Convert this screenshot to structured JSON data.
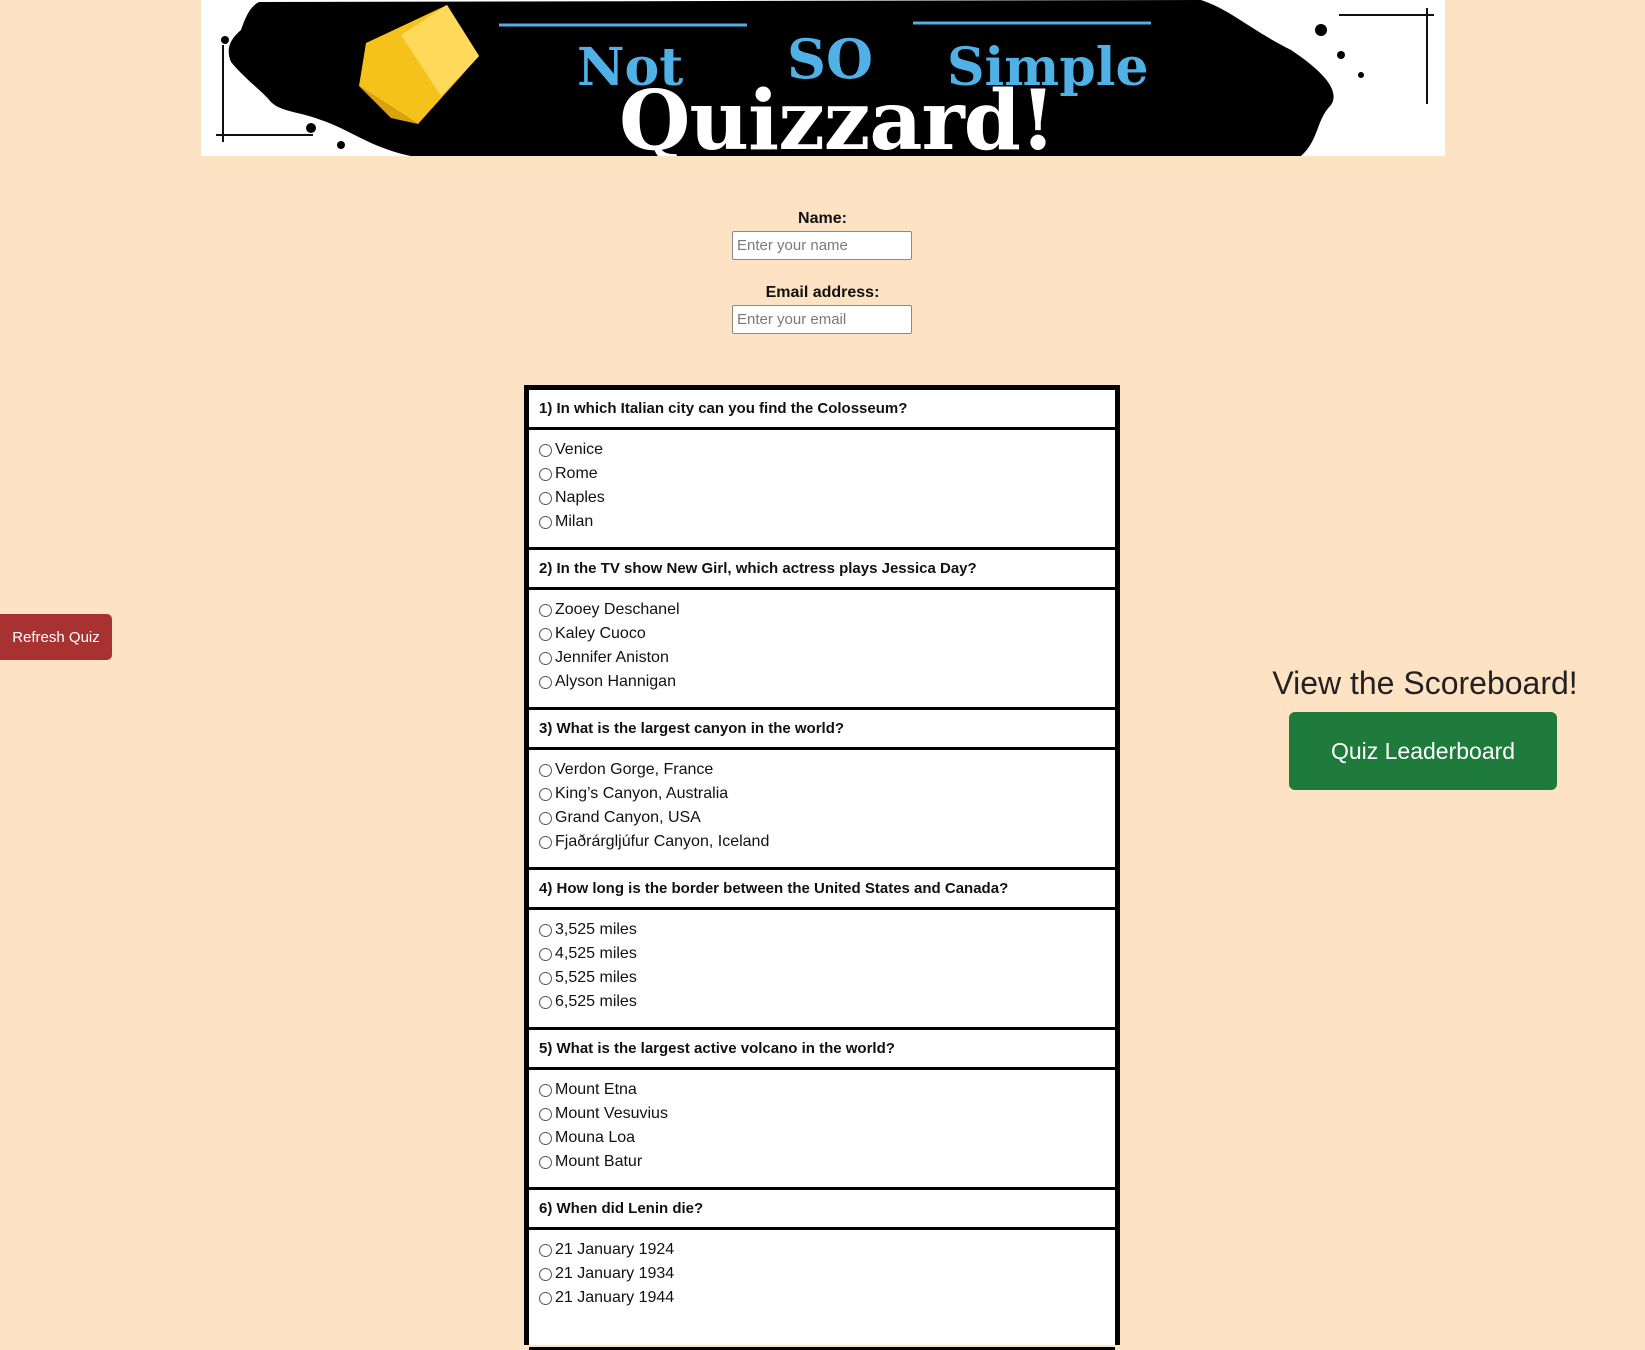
{
  "banner": {
    "word_not": "Not",
    "word_so": "SO",
    "word_simple": "Simple",
    "word_quizzard": "Quizzard!"
  },
  "form": {
    "name_label": "Name:",
    "name_placeholder": "Enter your name",
    "email_label": "Email address:",
    "email_placeholder": "Enter your email"
  },
  "refresh_button": "Refresh Quiz",
  "scoreboard": {
    "heading": "View the Scoreboard!",
    "button": "Quiz Leaderboard"
  },
  "questions": [
    {
      "text": "1) In which Italian city can you find the Colosseum?",
      "options": [
        "Venice",
        "Rome",
        "Naples",
        "Milan"
      ]
    },
    {
      "text": "2) In the TV show New Girl, which actress plays Jessica Day?",
      "options": [
        "Zooey Deschanel",
        "Kaley Cuoco",
        "Jennifer Aniston",
        "Alyson Hannigan"
      ]
    },
    {
      "text": "3) What is the largest canyon in the world?",
      "options": [
        "Verdon Gorge, France",
        "King’s Canyon, Australia",
        "Grand Canyon, USA",
        "Fjaðrárgljúfur Canyon, Iceland"
      ]
    },
    {
      "text": "4) How long is the border between the United States and Canada?",
      "options": [
        "3,525 miles",
        "4,525 miles",
        "5,525 miles",
        "6,525 miles"
      ]
    },
    {
      "text": "5) What is the largest active volcano in the world?",
      "options": [
        "Mount Etna",
        "Mount Vesuvius",
        "Mouna Loa",
        "Mount Batur"
      ]
    },
    {
      "text": "6) When did Lenin die?",
      "options": [
        "21 January 1924",
        "21 January 1934",
        "21 January 1944"
      ]
    }
  ],
  "colors": {
    "page_background": "#fde3c3",
    "banner_blue": "#4fb1e6",
    "crown_yellow": "#f5c21b",
    "refresh_red": "#a83232",
    "leaderboard_green": "#1e7b3c"
  }
}
